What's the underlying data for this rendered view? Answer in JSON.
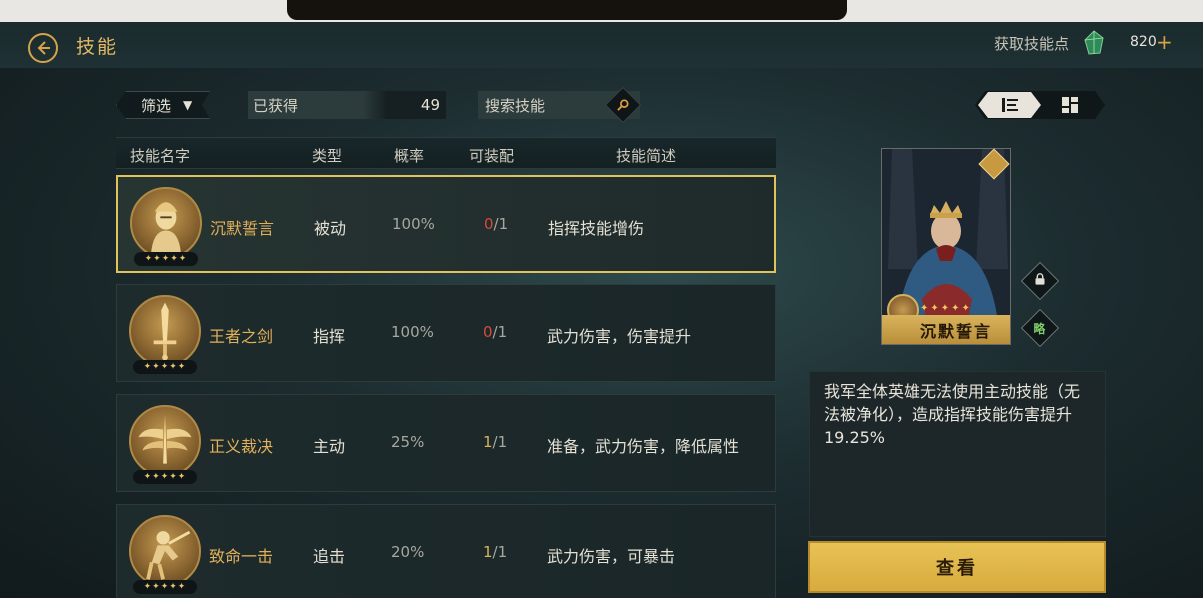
{
  "header": {
    "title": "技能",
    "skill_point_label": "获取技能点",
    "skill_point_value": "820",
    "plus": "+"
  },
  "toolbar": {
    "filter_label": "筛选",
    "obtained_label": "已获得",
    "obtained_count": "49",
    "search_placeholder": "搜索技能"
  },
  "table": {
    "columns": [
      "技能名字",
      "类型",
      "概率",
      "可装配",
      "技能简述"
    ],
    "rows": [
      {
        "name": "沉默誓言",
        "type": "被动",
        "rate": "100%",
        "equip_cur": "0",
        "equip_max": "/1",
        "desc": "指挥技能增伤",
        "stars": "✦✦✦✦✦",
        "rarity": 5
      },
      {
        "name": "王者之剑",
        "type": "指挥",
        "rate": "100%",
        "equip_cur": "0",
        "equip_max": "/1",
        "desc": "武力伤害，伤害提升",
        "stars": "✦✦✦✦✦",
        "rarity": 5
      },
      {
        "name": "正义裁决",
        "type": "主动",
        "rate": "25%",
        "equip_cur": "1",
        "equip_max": "/1",
        "desc": "准备，武力伤害，降低属性",
        "stars": "✦✦✦✦✦",
        "rarity": 5
      },
      {
        "name": "致命一击",
        "type": "追击",
        "rate": "20%",
        "equip_cur": "1",
        "equip_max": "/1",
        "desc": "武力伤害，可暴击",
        "stars": "✦✦✦✦✦",
        "rarity": 5
      }
    ]
  },
  "detail": {
    "card_name": "沉默誓言",
    "card_stars": "✦✦✦✦✦",
    "abbrev_label": "略",
    "description": "我军全体英雄无法使用主动技能（无法被净化），造成指挥技能伤害提升19.25%",
    "view_button": "查看"
  },
  "colors": {
    "accent_gold": "#e2b865",
    "selected_border": "#e2c25a",
    "unavailable_red": "#d84a3a",
    "button_gold": "#e8c255"
  }
}
